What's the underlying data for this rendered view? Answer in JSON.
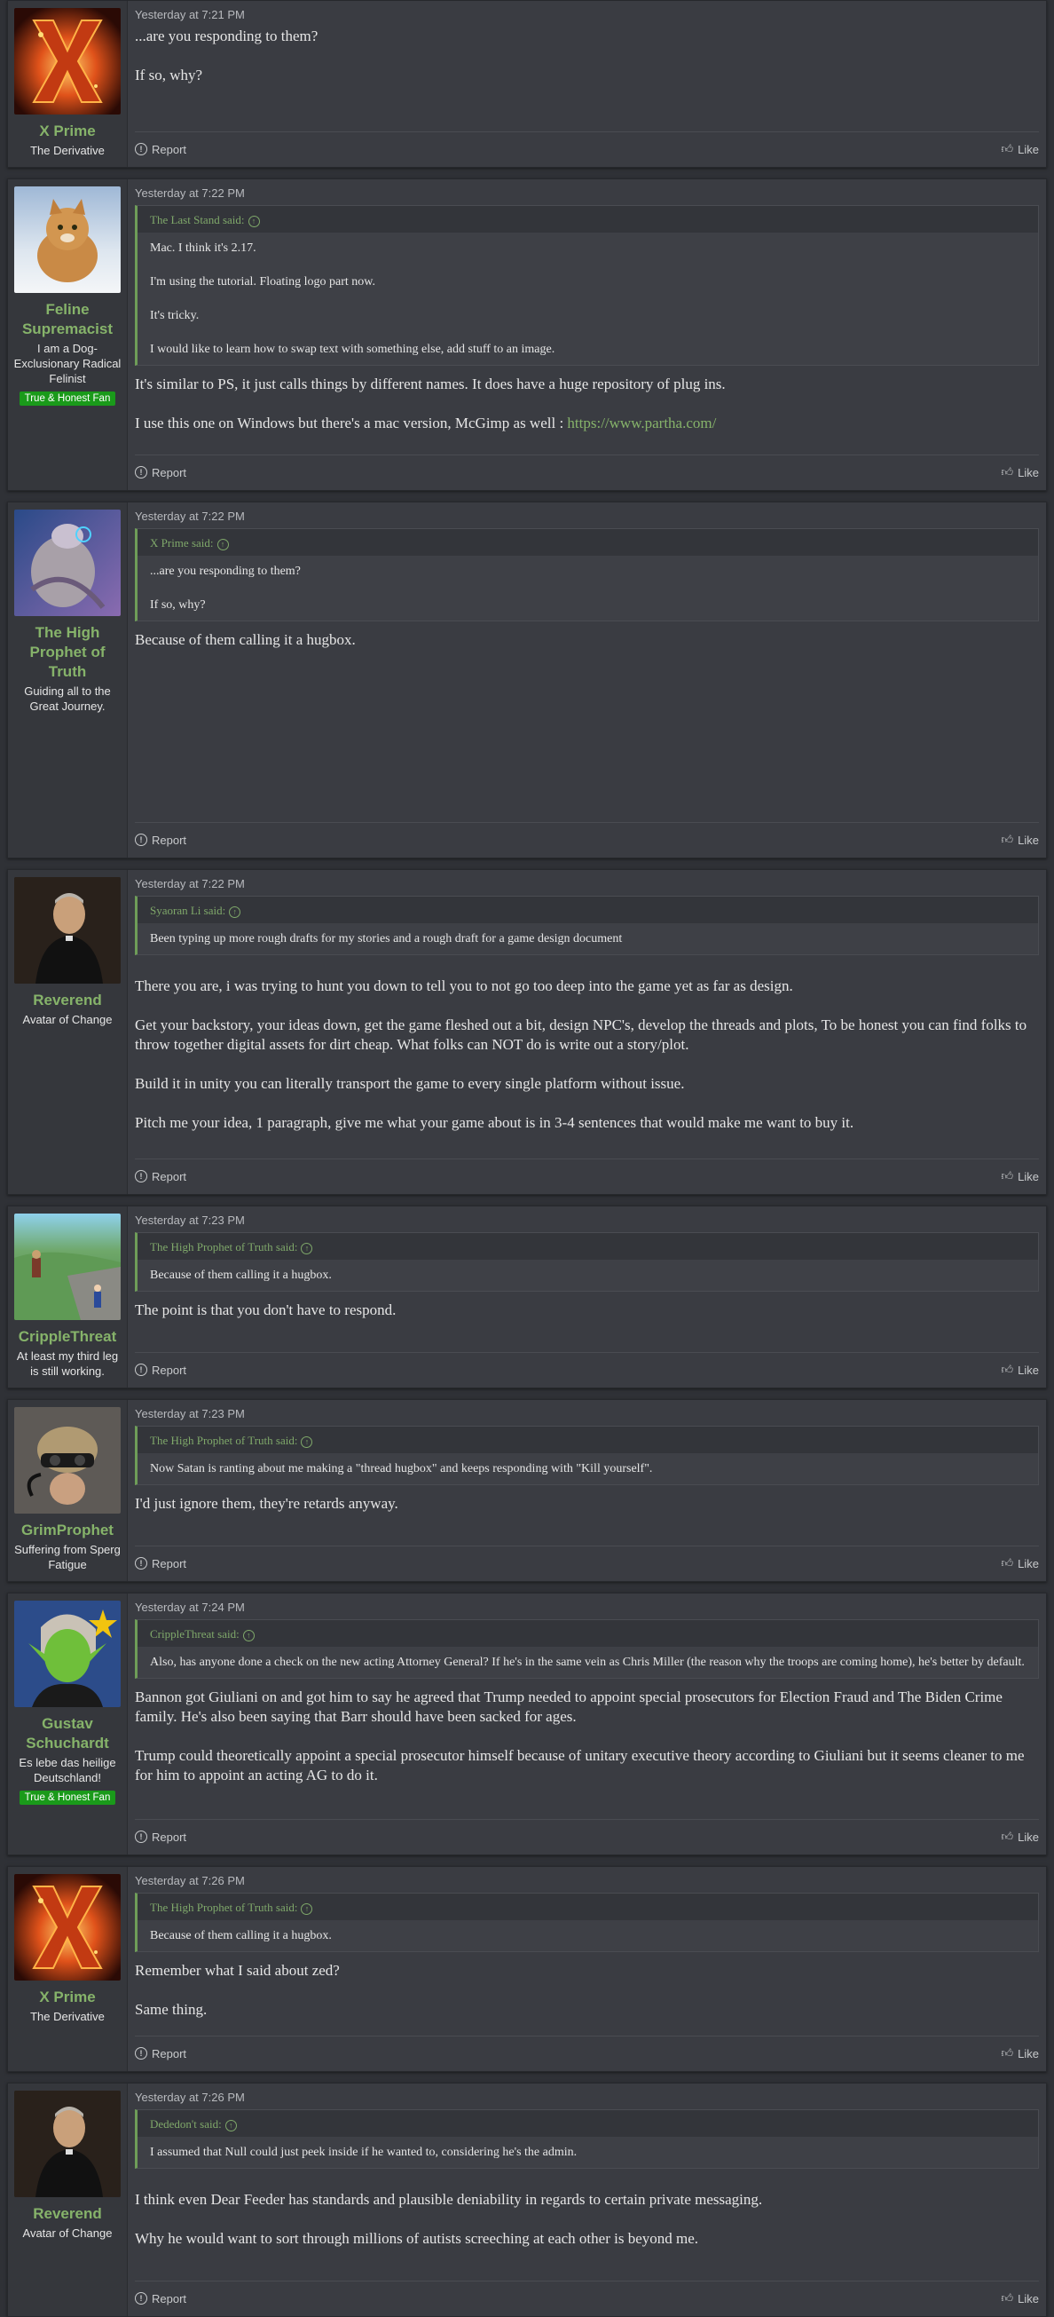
{
  "posts": [
    {
      "user": {
        "name": "X Prime",
        "title": "The Derivative",
        "banner": ""
      },
      "date": "Yesterday at 7:21 PM",
      "quote": null,
      "paragraphs": [
        "...are you responding to them?",
        "If so, why?"
      ],
      "link": null
    },
    {
      "user": {
        "name": "Feline Supremacist",
        "title": "I am a Dog-Exclusionary Radical Felinist",
        "banner": "True & Honest Fan"
      },
      "date": "Yesterday at 7:22 PM",
      "quote": {
        "author": "The Last Stand said:",
        "lines": [
          "Mac. I think it's 2.17.",
          "I'm using the tutorial. Floating logo part now.",
          "It's tricky.",
          "I would like to learn how to swap text with something else, add stuff to an image."
        ]
      },
      "paragraphs": [
        "It's similar to PS, it just calls things by different names. It does have a huge repository of plug ins.",
        "I use this one on Windows but there's a mac version, McGimp as well : "
      ],
      "link": "https://www.partha.com/"
    },
    {
      "user": {
        "name": "The High Prophet of Truth",
        "title": "Guiding all to the Great Journey.",
        "banner": ""
      },
      "date": "Yesterday at 7:22 PM",
      "quote": {
        "author": "X Prime said:",
        "lines": [
          "...are you responding to them?",
          "If so, why?"
        ]
      },
      "paragraphs": [
        "Because of them calling it a hugbox."
      ],
      "link": null
    },
    {
      "user": {
        "name": "Reverend",
        "title": "Avatar of Change",
        "banner": ""
      },
      "date": "Yesterday at 7:22 PM",
      "quote": {
        "author": "Syaoran Li said:",
        "lines": [
          "Been typing up more rough drafts for my stories and a rough draft for a game design document"
        ]
      },
      "paragraphs": [
        "There you are, i was trying to hunt you down to tell you to not go too deep into the game yet as far as design.",
        "Get your backstory, your ideas down, get the game fleshed out a bit, design NPC's, develop the threads and plots, To be honest you can find folks to throw together digital assets for dirt cheap. What folks can NOT do is write out a story/plot.",
        "Build it in unity you can literally transport the game to every single platform without issue.",
        "Pitch me your idea, 1 paragraph, give me what your game about is in 3-4 sentences that would make me want to buy it."
      ],
      "link": null
    },
    {
      "user": {
        "name": "CrippleThreat",
        "title": "At least my third leg is still working.",
        "banner": ""
      },
      "date": "Yesterday at 7:23 PM",
      "quote": {
        "author": "The High Prophet of Truth said:",
        "lines": [
          "Because of them calling it a hugbox."
        ]
      },
      "paragraphs": [
        "The point is that you don't have to respond."
      ],
      "link": null
    },
    {
      "user": {
        "name": "GrimProphet",
        "title": "Suffering from Sperg Fatigue",
        "banner": ""
      },
      "date": "Yesterday at 7:23 PM",
      "quote": {
        "author": "The High Prophet of Truth said:",
        "lines": [
          "Now Satan is ranting about me making a \"thread hugbox\" and keeps responding with \"Kill yourself\"."
        ]
      },
      "paragraphs": [
        "I'd just ignore them, they're retards anyway."
      ],
      "link": null
    },
    {
      "user": {
        "name": "Gustav Schuchardt",
        "title": "Es lebe das heilige Deutschland!",
        "banner": "True & Honest Fan"
      },
      "date": "Yesterday at 7:24 PM",
      "quote": {
        "author": "CrippleThreat said:",
        "lines": [
          "Also, has anyone done a check on the new acting Attorney General? If he's in the same vein as Chris Miller (the reason why the troops are coming home), he's better by default."
        ]
      },
      "paragraphs": [
        "Bannon got Giuliani on and got him to say he agreed that Trump needed to appoint special prosecutors for Election Fraud and The Biden Crime family. He's also been saying that Barr should have been sacked for ages.",
        "Trump could theoretically appoint a special prosecutor himself because of unitary executive theory according to Giuliani but it seems cleaner to me for him to appoint an acting AG to do it."
      ],
      "link": null
    },
    {
      "user": {
        "name": "X Prime",
        "title": "The Derivative",
        "banner": ""
      },
      "date": "Yesterday at 7:26 PM",
      "quote": {
        "author": "The High Prophet of Truth said:",
        "lines": [
          "Because of them calling it a hugbox."
        ]
      },
      "paragraphs": [
        "Remember what I said about zed?",
        "Same thing."
      ],
      "link": null
    },
    {
      "user": {
        "name": "Reverend",
        "title": "Avatar of Change",
        "banner": ""
      },
      "date": "Yesterday at 7:26 PM",
      "quote": {
        "author": "Dededon't said:",
        "lines": [
          "I assumed that Null could just peek inside if he wanted to, considering he's the admin."
        ]
      },
      "paragraphs": [
        "I think even Dear Feeder has standards and plausible deniability in regards to certain private messaging.",
        "Why he would want to sort through millions of autists screeching at each other is beyond me."
      ],
      "link": null
    }
  ],
  "actions": {
    "report": "Report",
    "like": "Like"
  },
  "avatars": [
    "x-logo-fire",
    "cat-in-snow",
    "alien-prophet",
    "man-in-black",
    "cartoon-landscape",
    "man-with-goggles",
    "green-elf-woman",
    "x-logo-fire",
    "man-in-black"
  ],
  "colors": {
    "accent": "#86b36a",
    "banner": "#1a9a1a",
    "background": "#2f3136",
    "panel": "#3a3c42"
  }
}
